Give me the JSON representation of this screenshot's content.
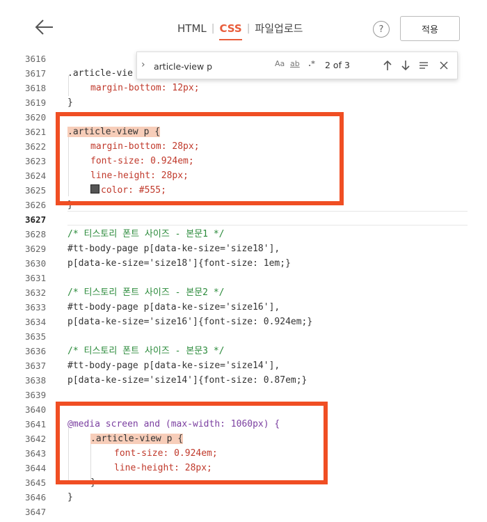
{
  "header": {
    "tabs": [
      {
        "label": "HTML",
        "active": false
      },
      {
        "label": "CSS",
        "active": true
      },
      {
        "label": "파일업로드",
        "active": false
      }
    ],
    "help_label": "?",
    "apply_label": "적용"
  },
  "find": {
    "value": "article-view p",
    "match_case": "Aa",
    "whole_word": "ab",
    "regex": ".*",
    "count": "2 of 3"
  },
  "lines": [
    {
      "n": "3616",
      "c": ""
    },
    {
      "n": "3617",
      "c": ".article-vie"
    },
    {
      "n": "3618",
      "c": "margin-bottom: 12px;"
    },
    {
      "n": "3619",
      "c": "}"
    },
    {
      "n": "3620",
      "c": ""
    },
    {
      "n": "3621",
      "c": ".article-view p {"
    },
    {
      "n": "3622",
      "c": "margin-bottom: 28px;"
    },
    {
      "n": "3623",
      "c": "font-size: 0.924em;"
    },
    {
      "n": "3624",
      "c": "line-height: 28px;"
    },
    {
      "n": "3625",
      "c": "color: #555;"
    },
    {
      "n": "3626",
      "c": "}"
    },
    {
      "n": "3627",
      "c": ""
    },
    {
      "n": "3628",
      "c": "/* 티스토리 폰트 사이즈 - 본문1 */"
    },
    {
      "n": "3629",
      "c": "#tt-body-page p[data-ke-size='size18'],"
    },
    {
      "n": "3630",
      "c": "p[data-ke-size='size18']{font-size: 1em;}"
    },
    {
      "n": "3631",
      "c": ""
    },
    {
      "n": "3632",
      "c": "/* 티스토리 폰트 사이즈 - 본문2 */"
    },
    {
      "n": "3633",
      "c": "#tt-body-page p[data-ke-size='size16'],"
    },
    {
      "n": "3634",
      "c": "p[data-ke-size='size16']{font-size: 0.924em;}"
    },
    {
      "n": "3635",
      "c": ""
    },
    {
      "n": "3636",
      "c": "/* 티스토리 폰트 사이즈 - 본문3 */"
    },
    {
      "n": "3637",
      "c": "#tt-body-page p[data-ke-size='size14'],"
    },
    {
      "n": "3638",
      "c": "p[data-ke-size='size14']{font-size: 0.87em;}"
    },
    {
      "n": "3639",
      "c": ""
    },
    {
      "n": "3640",
      "c": ""
    },
    {
      "n": "3641",
      "c": "@media screen and (max-width: 1060px) {"
    },
    {
      "n": "3642",
      "c": ".article-view p {"
    },
    {
      "n": "3643",
      "c": "font-size: 0.924em;"
    },
    {
      "n": "3644",
      "c": "line-height: 28px;"
    },
    {
      "n": "3645",
      "c": "}"
    },
    {
      "n": "3646",
      "c": "}"
    },
    {
      "n": "3647",
      "c": ""
    }
  ],
  "colors": {
    "accent": "#e85c3a",
    "highlight_box": "#f04e23",
    "match_highlight": "#f7cdb9",
    "swatch": "#555555"
  },
  "icons": [
    "back-arrow-icon",
    "chevron-right-icon",
    "arrow-up-icon",
    "arrow-down-icon",
    "selection-icon",
    "close-icon"
  ]
}
